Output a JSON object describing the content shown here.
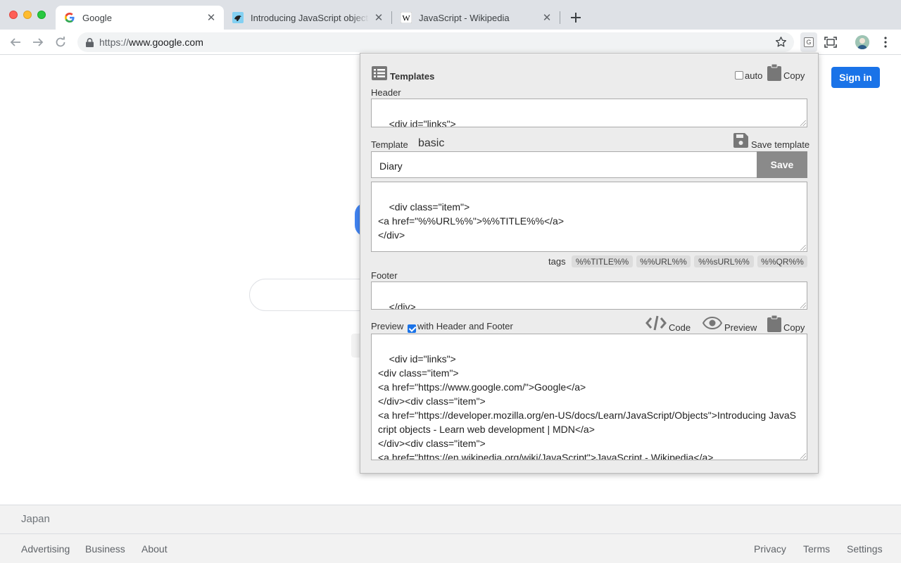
{
  "browser": {
    "tabs": [
      {
        "title": "Google",
        "favicon": "google-g-icon",
        "active": true
      },
      {
        "title": "Introducing JavaScript objects",
        "favicon": "mdn-dino-icon",
        "active": false
      },
      {
        "title": "JavaScript - Wikipedia",
        "favicon": "wikipedia-w-icon",
        "active": false
      }
    ],
    "url_scheme": "https://",
    "url_host": "www.google.com"
  },
  "google": {
    "sign_in": "Sign in",
    "country": "Japan",
    "footer_left": [
      "Advertising",
      "Business",
      "About"
    ],
    "footer_right": [
      "Privacy",
      "Terms",
      "Settings"
    ]
  },
  "popup": {
    "title": "Templates",
    "auto_label": "auto",
    "copy_label": "Copy",
    "header_label": "Header",
    "header_value": "<div id=\"links\">",
    "template_label": "Template",
    "template_name": "basic",
    "save_template_label": "Save template",
    "template_name_input": "Diary",
    "save_button": "Save",
    "template_body": "<div class=\"item\">\n<a href=\"%%URL%%\">%%TITLE%%</a>\n</div>",
    "tags_label": "tags",
    "tags": [
      "%%TITLE%%",
      "%%URL%%",
      "%%sURL%%",
      "%%QR%%"
    ],
    "footer_label": "Footer",
    "footer_value": "</div>",
    "preview_label": "Preview",
    "with_header_footer_label": "with Header and Footer",
    "with_header_footer_checked": true,
    "auto_checked": false,
    "code_label": "Code",
    "preview_mode_label": "Preview",
    "preview_copy_label": "Copy",
    "preview_output": "<div id=\"links\">\n<div class=\"item\">\n<a href=\"https://www.google.com/\">Google</a>\n</div><div class=\"item\">\n<a href=\"https://developer.mozilla.org/en-US/docs/Learn/JavaScript/Objects\">Introducing JavaScript objects - Learn web development | MDN</a>\n</div><div class=\"item\">\n<a href=\"https://en.wikipedia.org/wiki/JavaScript\">JavaScript - Wikipedia</a>\n</div></div>"
  }
}
